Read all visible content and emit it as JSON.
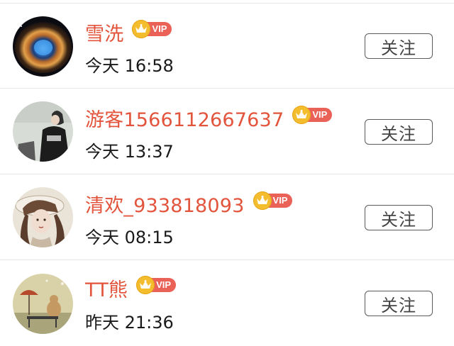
{
  "users": [
    {
      "name": "雪洗",
      "time": "今天 16:58",
      "vip_label": "VIP",
      "follow_label": "关注",
      "avatar": "nebula-avatar"
    },
    {
      "name": "游客1566112667637",
      "time": "今天 13:37",
      "vip_label": "VIP",
      "follow_label": "关注",
      "avatar": "girl-photo-avatar"
    },
    {
      "name": "清欢_933818093",
      "time": "今天 08:15",
      "vip_label": "VIP",
      "follow_label": "关注",
      "avatar": "illustrated-girl-avatar"
    },
    {
      "name": "TT熊",
      "time": "昨天 21:36",
      "vip_label": "VIP",
      "follow_label": "关注",
      "avatar": "umbrella-painting-avatar"
    }
  ],
  "colors": {
    "name": "#e2543c",
    "vip_tag": "#e96157",
    "crown": "#f3bd2e"
  }
}
